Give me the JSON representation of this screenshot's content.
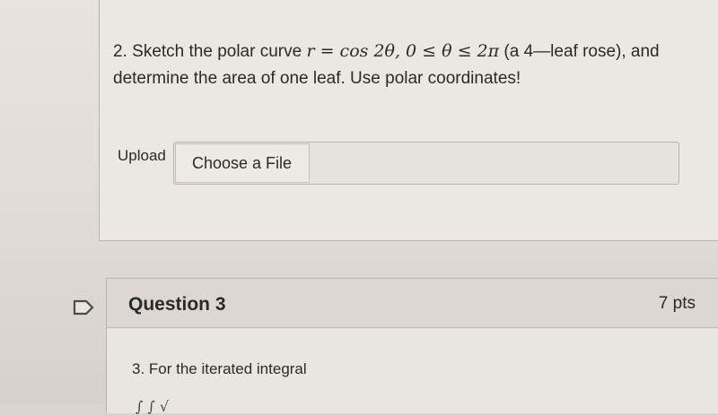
{
  "question2": {
    "number": "2.",
    "text_before": "Sketch the polar curve",
    "math": "r = cos 2θ, 0 ≤ θ ≤ 2π",
    "text_after": "(a 4—leaf rose), and",
    "line2": "determine the area of one leaf. Use polar coordinates!"
  },
  "upload": {
    "label": "Upload",
    "button": "Choose a File"
  },
  "question3": {
    "title": "Question 3",
    "points": "7 pts",
    "text": "3. For the iterated integral",
    "cut_math": "∫ ∫ √"
  }
}
